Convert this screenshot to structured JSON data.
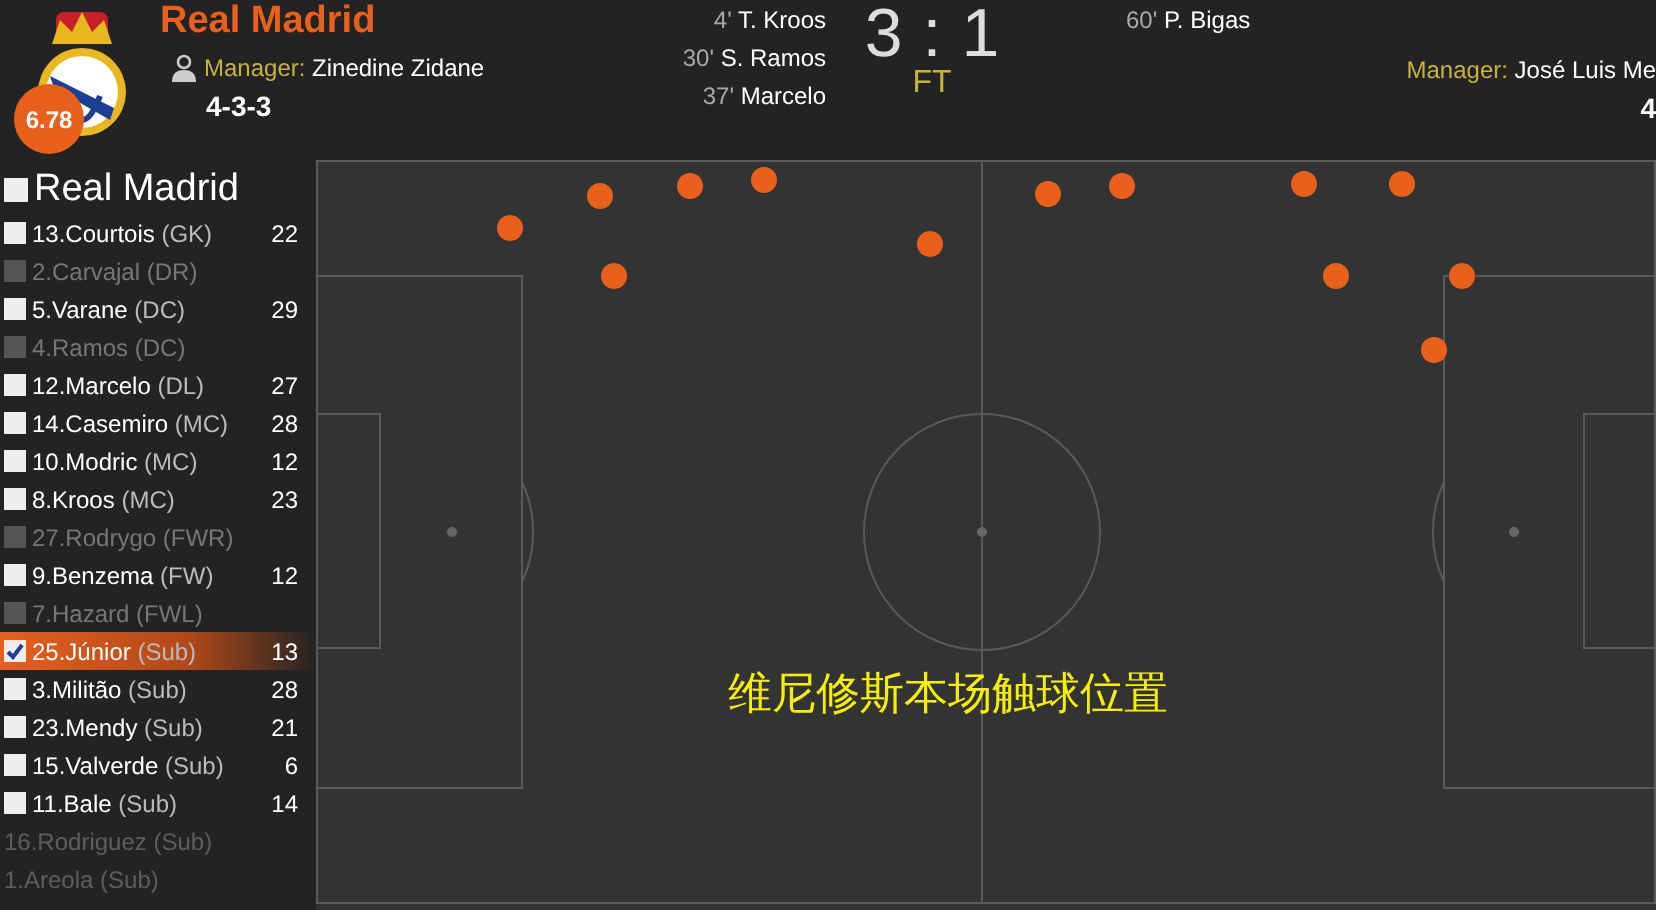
{
  "header": {
    "team": "Real Madrid",
    "rating": "6.78",
    "manager_label": "Manager:",
    "manager": "Zinedine Zidane",
    "formation": "4-3-3",
    "home_goals": [
      {
        "minute": "4'",
        "player": "T. Kroos"
      },
      {
        "minute": "30'",
        "player": "S. Ramos"
      },
      {
        "minute": "37'",
        "player": "Marcelo"
      }
    ],
    "score": {
      "home": "3",
      "separator": ":",
      "away": "1",
      "status": "FT"
    },
    "away_goals": [
      {
        "minute": "60'",
        "player": "P. Bigas"
      }
    ],
    "away_manager_label": "Manager:",
    "away_manager": "José Luis Me",
    "away_formation": "4"
  },
  "sidebar": {
    "team": {
      "label": "Real Madrid",
      "checked": false
    },
    "players": [
      {
        "kind": "player",
        "name": "13.Courtois",
        "position": "(GK)",
        "touches": "22",
        "checked": false,
        "disabled": false
      },
      {
        "kind": "player",
        "name": "2.Carvajal",
        "position": "(DR)",
        "checked": false,
        "disabled": true
      },
      {
        "kind": "player",
        "name": "5.Varane",
        "position": "(DC)",
        "touches": "29",
        "checked": false,
        "disabled": false
      },
      {
        "kind": "player",
        "name": "4.Ramos",
        "position": "(DC)",
        "checked": false,
        "disabled": true
      },
      {
        "kind": "player",
        "name": "12.Marcelo",
        "position": "(DL)",
        "touches": "27",
        "checked": false,
        "disabled": false
      },
      {
        "kind": "player",
        "name": "14.Casemiro",
        "position": "(MC)",
        "touches": "28",
        "checked": false,
        "disabled": false
      },
      {
        "kind": "player",
        "name": "10.Modric",
        "position": "(MC)",
        "touches": "12",
        "checked": false,
        "disabled": false
      },
      {
        "kind": "player",
        "name": "8.Kroos",
        "position": "(MC)",
        "touches": "23",
        "checked": false,
        "disabled": false
      },
      {
        "kind": "player",
        "name": "27.Rodrygo",
        "position": "(FWR)",
        "checked": false,
        "disabled": true
      },
      {
        "kind": "player",
        "name": "9.Benzema",
        "position": "(FW)",
        "touches": "12",
        "checked": false,
        "disabled": false
      },
      {
        "kind": "player",
        "name": "7.Hazard",
        "position": "(FWL)",
        "checked": false,
        "disabled": true
      },
      {
        "kind": "player",
        "name": "25.Júnior",
        "position": "(Sub)",
        "touches": "13",
        "checked": true,
        "disabled": false
      },
      {
        "kind": "player",
        "name": "3.Militão",
        "position": "(Sub)",
        "touches": "28",
        "checked": false,
        "disabled": false
      },
      {
        "kind": "player",
        "name": "23.Mendy",
        "position": "(Sub)",
        "touches": "21",
        "checked": false,
        "disabled": false
      },
      {
        "kind": "player",
        "name": "15.Valverde",
        "position": "(Sub)",
        "touches": "6",
        "checked": false,
        "disabled": false
      },
      {
        "kind": "player",
        "name": "11.Bale",
        "position": "(Sub)",
        "touches": "14",
        "checked": false,
        "disabled": false
      },
      {
        "kind": "unused",
        "name": "16.Rodriguez",
        "position": "(Sub)"
      },
      {
        "kind": "unused",
        "name": "1.Areola",
        "position": "(Sub)"
      }
    ]
  },
  "pitch": {
    "caption": "维尼修斯本场触球位置"
  }
}
